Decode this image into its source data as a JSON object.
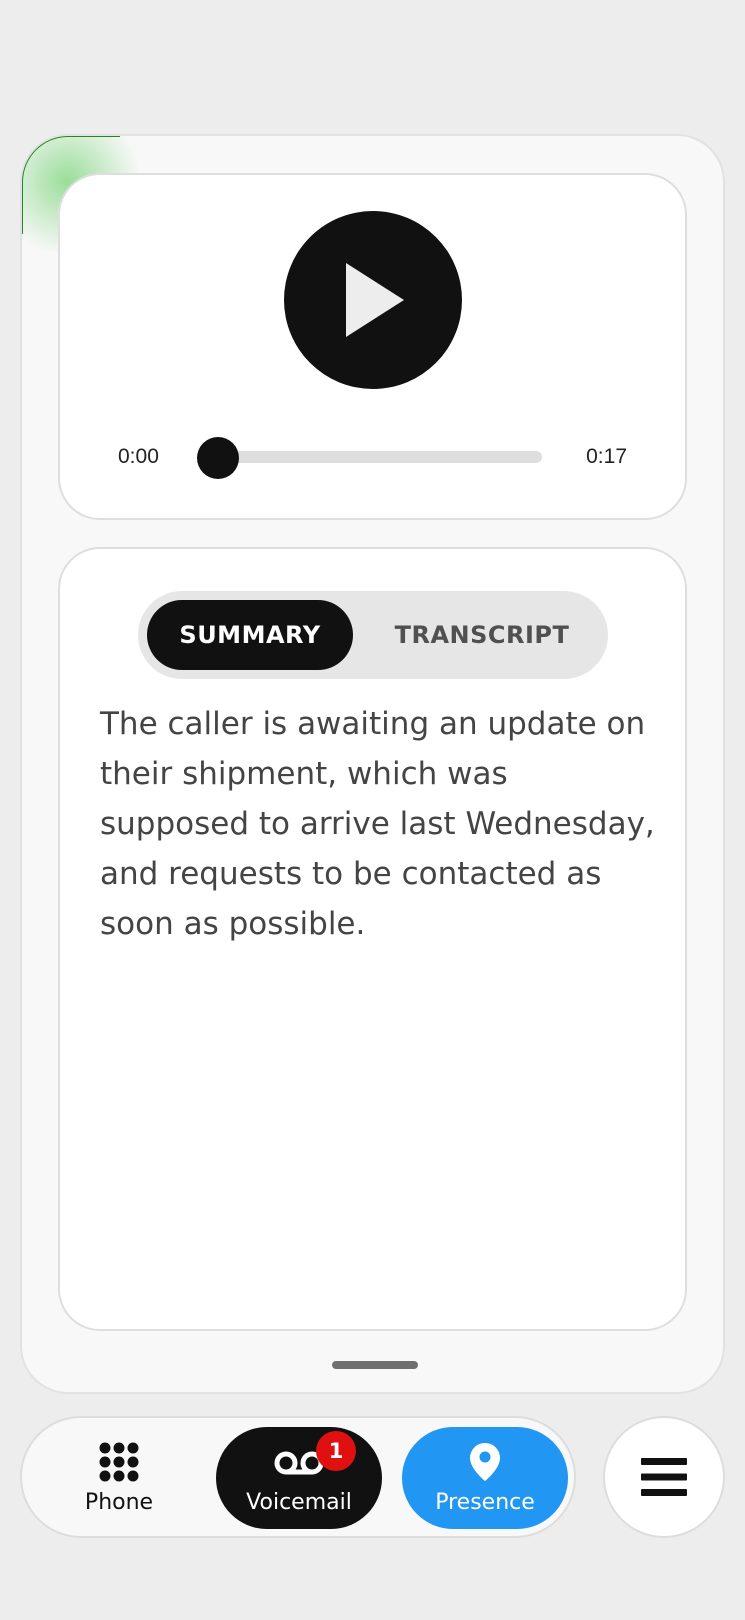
{
  "player": {
    "current_time": "0:00",
    "total_time": "0:17",
    "progress": 0
  },
  "summary": {
    "tabs": [
      {
        "label": "SUMMARY",
        "active": true
      },
      {
        "label": "TRANSCRIPT",
        "active": false
      }
    ],
    "text": "The caller is awaiting an update on their shipment, which was supposed to arrive last Wednesday, and requests to be contacted as soon as possible."
  },
  "nav": {
    "items": [
      {
        "label": "Phone",
        "icon": "keypad-icon"
      },
      {
        "label": "Voicemail",
        "icon": "voicemail-icon",
        "badge": "1"
      },
      {
        "label": "Presence",
        "icon": "location-pin-icon"
      }
    ],
    "menu_icon": "hamburger-menu-icon"
  },
  "colors": {
    "accent_blue": "#2196f3",
    "badge_red": "#e01010",
    "active_dark": "#111111",
    "presence_glow": "#1f8a1f"
  }
}
